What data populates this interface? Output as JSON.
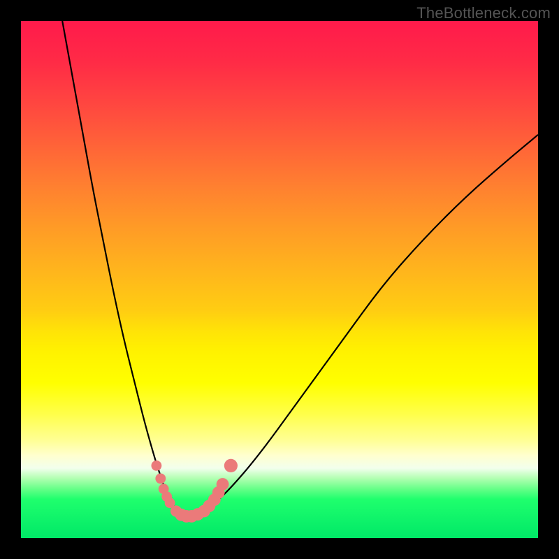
{
  "watermark": {
    "text": "TheBottleneck.com"
  },
  "colors": {
    "curve": "#000000",
    "markers": "#eb7a7a",
    "background_frame": "#000000"
  },
  "chart_data": {
    "type": "line",
    "title": "",
    "xlabel": "",
    "ylabel": "",
    "xlim": [
      0,
      100
    ],
    "ylim": [
      0,
      100
    ],
    "grid": false,
    "legend": false,
    "series": [
      {
        "name": "bottleneck-curve",
        "x": [
          8,
          10,
          12,
          14,
          16,
          18,
          20,
          22,
          24,
          26,
          27,
          28,
          29,
          30,
          31,
          32,
          33,
          34,
          36,
          40,
          46,
          54,
          62,
          70,
          78,
          86,
          94,
          100
        ],
        "y": [
          100,
          89,
          78,
          67,
          57,
          47,
          38,
          30,
          22,
          15,
          12,
          9,
          7,
          5.5,
          4.5,
          4.2,
          4.2,
          4.5,
          5.5,
          9,
          16,
          27,
          38,
          49,
          58,
          66,
          73,
          78
        ]
      }
    ],
    "markers": [
      {
        "x": 26.2,
        "y": 14.0,
        "r": 1.0
      },
      {
        "x": 27.0,
        "y": 11.5,
        "r": 1.0
      },
      {
        "x": 27.6,
        "y": 9.5,
        "r": 1.0
      },
      {
        "x": 28.2,
        "y": 8.0,
        "r": 1.0
      },
      {
        "x": 28.8,
        "y": 6.8,
        "r": 1.0
      },
      {
        "x": 30.0,
        "y": 5.2,
        "r": 1.1
      },
      {
        "x": 31.0,
        "y": 4.5,
        "r": 1.2
      },
      {
        "x": 32.0,
        "y": 4.2,
        "r": 1.2
      },
      {
        "x": 33.0,
        "y": 4.2,
        "r": 1.2
      },
      {
        "x": 34.2,
        "y": 4.6,
        "r": 1.2
      },
      {
        "x": 35.4,
        "y": 5.2,
        "r": 1.2
      },
      {
        "x": 36.4,
        "y": 6.2,
        "r": 1.2
      },
      {
        "x": 37.4,
        "y": 7.4,
        "r": 1.2
      },
      {
        "x": 38.2,
        "y": 8.8,
        "r": 1.2
      },
      {
        "x": 39.0,
        "y": 10.4,
        "r": 1.2
      },
      {
        "x": 40.6,
        "y": 14.0,
        "r": 1.3
      }
    ]
  }
}
